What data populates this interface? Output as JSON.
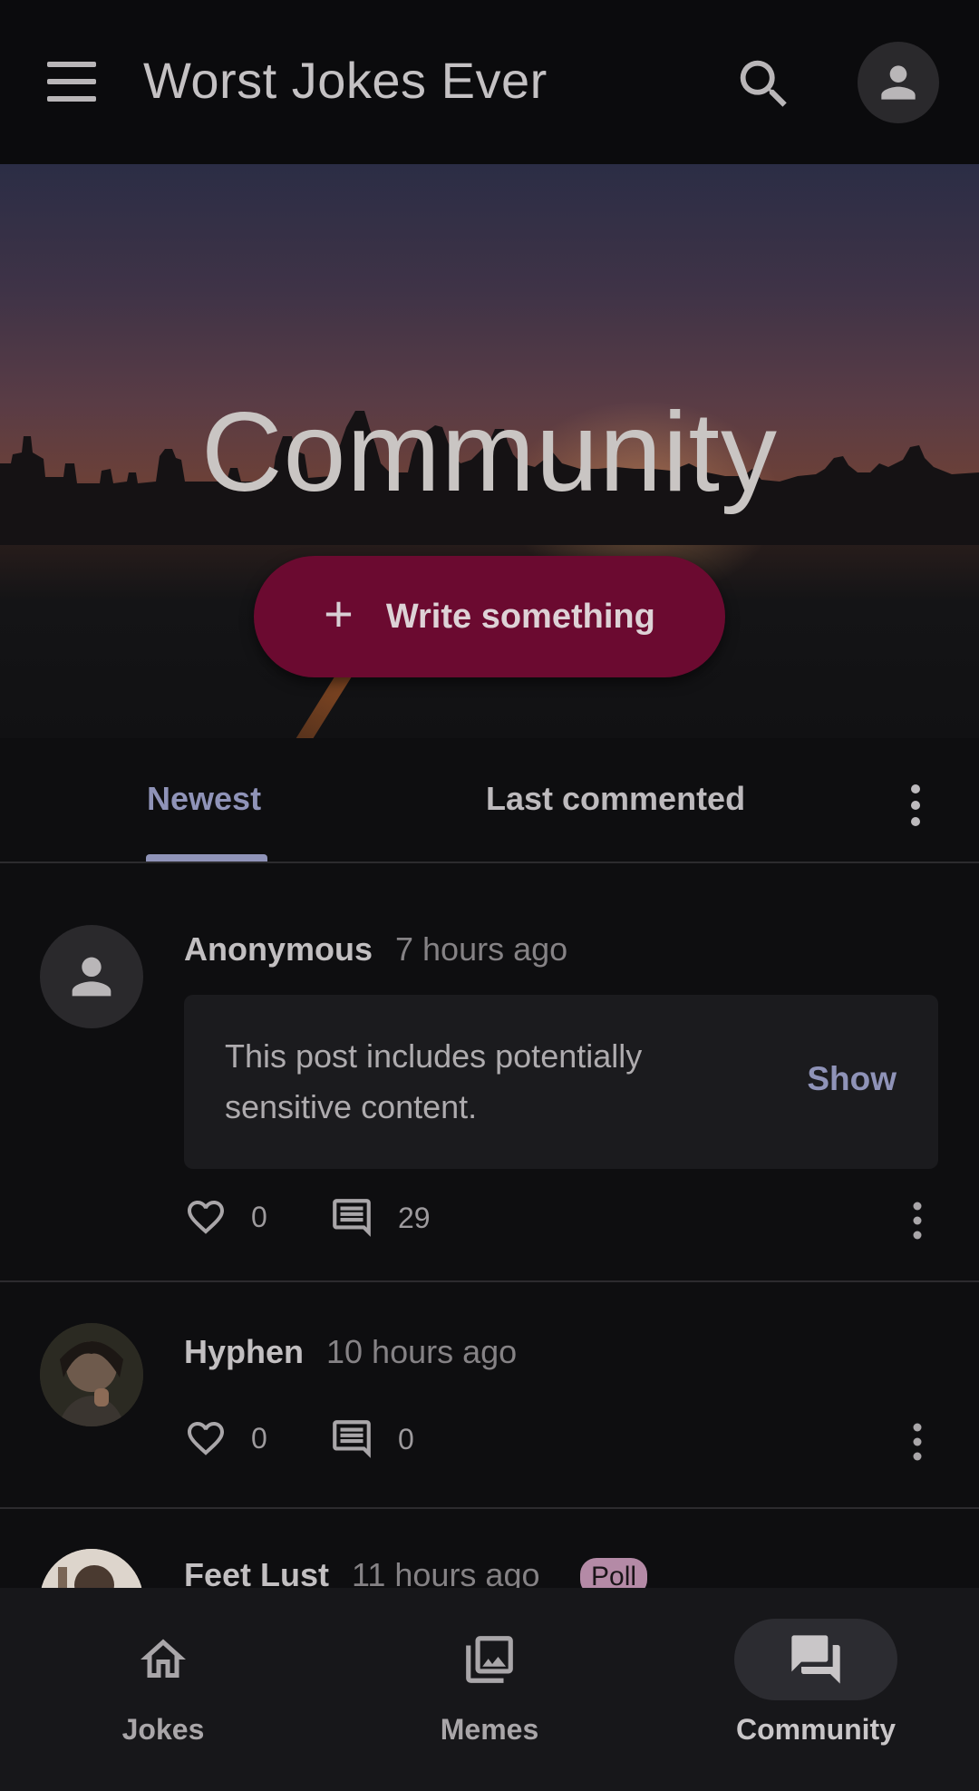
{
  "app_bar": {
    "title": "Worst Jokes Ever",
    "menu_icon": "menu-icon",
    "search_icon": "search-icon",
    "account_icon": "account-icon"
  },
  "hero": {
    "title": "Community",
    "write_button": {
      "icon": "plus-icon",
      "label": "Write something"
    }
  },
  "tabs": {
    "items": [
      {
        "label": "Newest",
        "selected": true
      },
      {
        "label": "Last commented",
        "selected": false
      }
    ],
    "more_icon": "more-vert-icon"
  },
  "posts": [
    {
      "author": "Anonymous",
      "time": "7 hours ago",
      "sensitive_notice": "This post includes potentially sensitive content.",
      "show_label": "Show",
      "likes": "0",
      "comments": "29"
    },
    {
      "author": "Hyphen",
      "time": "10 hours ago",
      "likes": "0",
      "comments": "0"
    },
    {
      "author": "Feet Lust",
      "time": "11 hours ago",
      "badge": "Poll"
    }
  ],
  "bottom_nav": {
    "items": [
      {
        "label": "Jokes",
        "icon": "home-icon",
        "active": false
      },
      {
        "label": "Memes",
        "icon": "gallery-icon",
        "active": false
      },
      {
        "label": "Community",
        "icon": "forum-icon",
        "active": true
      }
    ]
  },
  "colors": {
    "accent": "#8f93b8",
    "primary_button": "#6b0a30",
    "background": "#0e0e10",
    "poll_badge": "#b48aa6"
  }
}
